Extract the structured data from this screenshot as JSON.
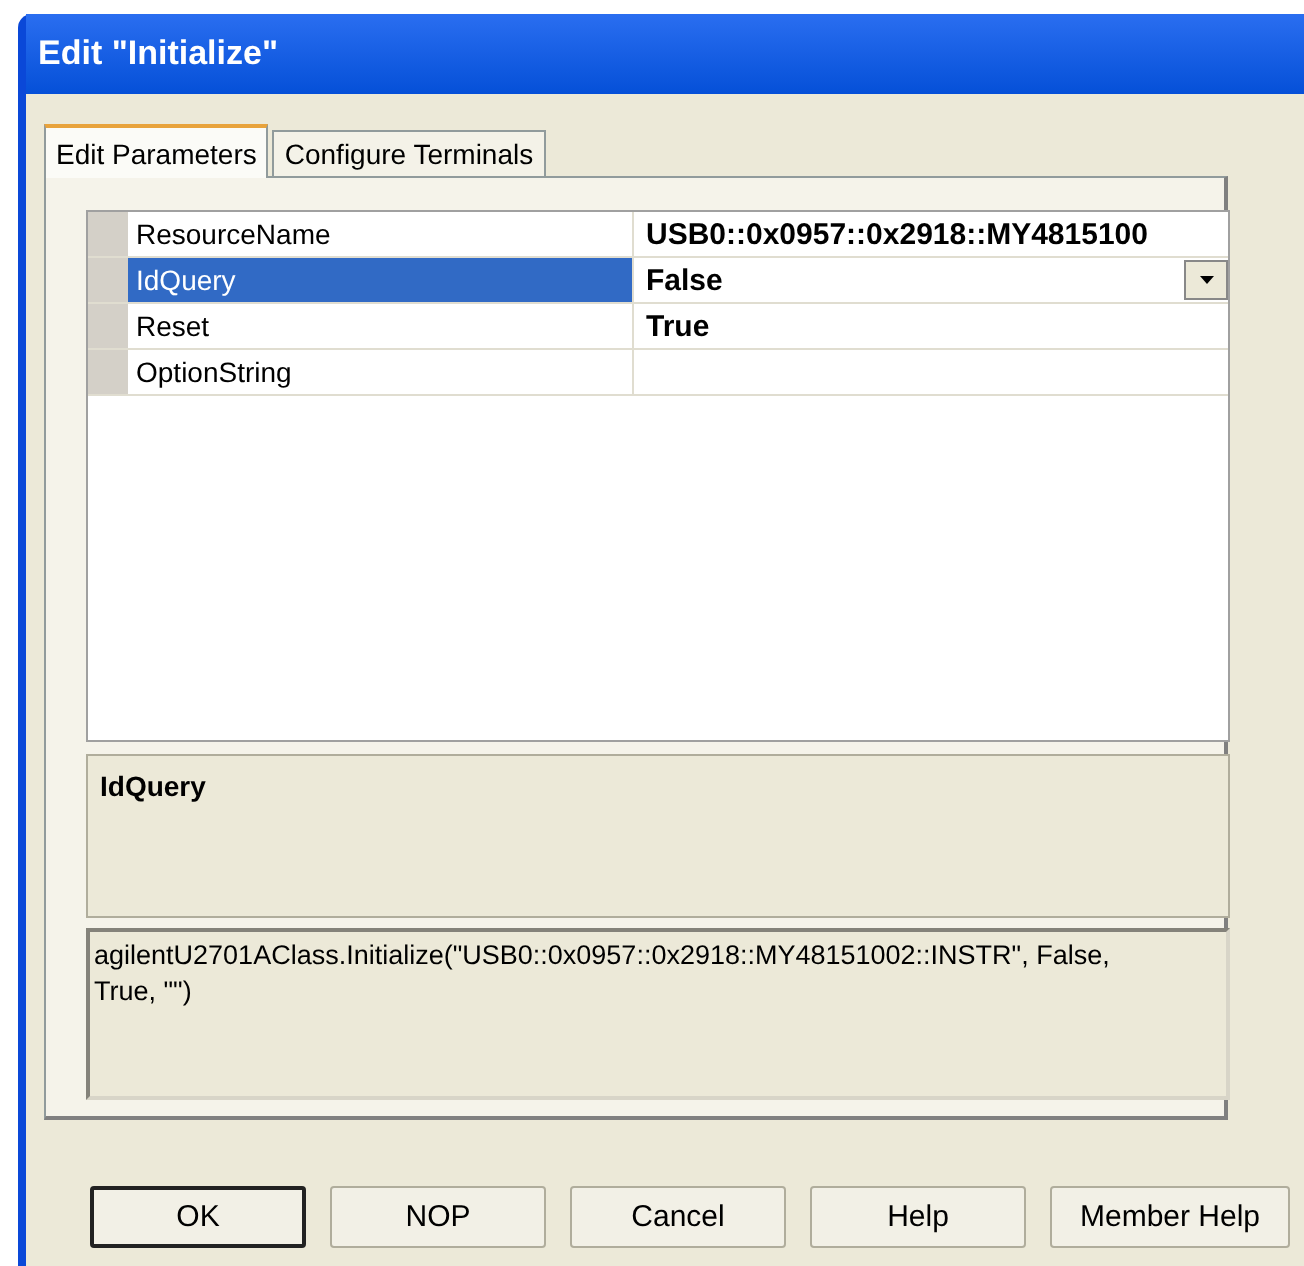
{
  "window": {
    "title": "Edit \"Initialize\""
  },
  "tabs": [
    {
      "label": "Edit Parameters",
      "selected": true
    },
    {
      "label": "Configure Terminals",
      "selected": false
    }
  ],
  "parameters": [
    {
      "name": "ResourceName",
      "value": "USB0::0x0957::0x2918::MY4815100",
      "selected": false
    },
    {
      "name": "IdQuery",
      "value": "False",
      "selected": true
    },
    {
      "name": "Reset",
      "value": "True",
      "selected": false
    },
    {
      "name": "OptionString",
      "selected": false
    }
  ],
  "description": {
    "title": "IdQuery"
  },
  "code_preview": "agilentU2701AClass.Initialize(\"USB0::0x0957::0x2918::MY48151002::INSTR\", False, True, \"\")",
  "buttons": [
    {
      "label": "OK",
      "default": true
    },
    {
      "label": "NOP",
      "default": false
    },
    {
      "label": "Cancel",
      "default": false
    },
    {
      "label": "Help",
      "default": false
    },
    {
      "label": "Member Help",
      "default": false
    }
  ]
}
